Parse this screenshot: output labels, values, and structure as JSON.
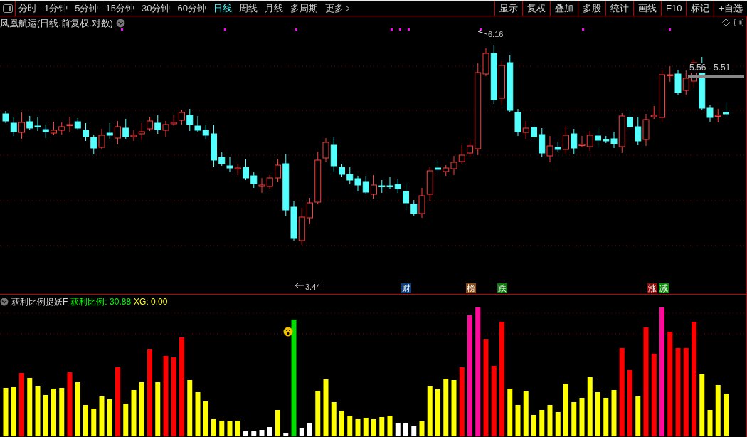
{
  "toolbar": {
    "periods": [
      {
        "label": "分时",
        "selected": false
      },
      {
        "label": "1分钟",
        "selected": false
      },
      {
        "label": "5分钟",
        "selected": false
      },
      {
        "label": "15分钟",
        "selected": false
      },
      {
        "label": "30分钟",
        "selected": false
      },
      {
        "label": "60分钟",
        "selected": false
      },
      {
        "label": "日线",
        "selected": true
      },
      {
        "label": "周线",
        "selected": false
      },
      {
        "label": "月线",
        "selected": false
      },
      {
        "label": "多周期",
        "selected": false
      }
    ],
    "more": "更多",
    "buttons": [
      "显示",
      "复权",
      "叠加",
      "多股",
      "统计",
      "画线",
      "F10",
      "标记",
      "+自选"
    ]
  },
  "chart": {
    "title": "凤凰航运(日线.前复权.对数)",
    "high_label": "6.16",
    "low_label": "3.44",
    "range_label": "5.56 - 5.51",
    "events": [
      {
        "label": "财",
        "color": "#0b3f80"
      },
      {
        "label": "榜",
        "color": "#8a4a14"
      },
      {
        "label": "跌",
        "color": "#0a7a0a"
      },
      {
        "label": "涨",
        "color": "#8a0a0a"
      },
      {
        "label": "减",
        "color": "#0a8a0a"
      }
    ]
  },
  "indicator": {
    "name": "获利比例捉妖F",
    "values": [
      {
        "label": "获利比例:",
        "value": "30.88",
        "color": "#00ff00"
      },
      {
        "label": "XG:",
        "value": "0.00",
        "color": "#ffff00"
      }
    ]
  }
}
